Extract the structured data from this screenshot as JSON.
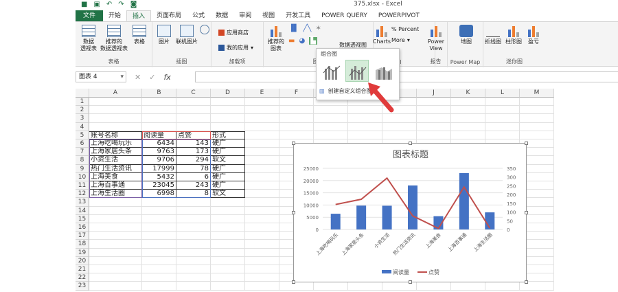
{
  "window": {
    "title": "375.xlsx - Excel"
  },
  "ribbon": {
    "tabs": [
      "文件",
      "开始",
      "插入",
      "页面布局",
      "公式",
      "数据",
      "审阅",
      "视图",
      "开发工具",
      "POWER QUERY",
      "POWERPIVOT"
    ],
    "active_tab": "插入",
    "groups": {
      "tables": {
        "label": "表格",
        "pivot": "数据\n透视表",
        "recommended_pivot": "推荐的\n数据透视表",
        "table": "表格"
      },
      "illustrations": {
        "label": "插图",
        "picture": "图片",
        "online_picture": "联机图片"
      },
      "addins": {
        "label": "加载项",
        "store": "应用商店",
        "my_apps": "我的应用"
      },
      "charts": {
        "label": "图表",
        "recommended": "推荐的\n图表",
        "pivot_chart": "数据透视图"
      },
      "extra_charts": {
        "charts": "Charts",
        "percent": "% Percent",
        "more": "More",
        "ll": "ll"
      },
      "reports": {
        "label": "报告",
        "power_view": "Power\nView"
      },
      "powermap": {
        "label": "Power Map",
        "map": "地图"
      },
      "sparklines": {
        "label": "迷你图",
        "line": "折线图",
        "column": "柱形图",
        "winloss": "盈亏"
      }
    }
  },
  "formula_bar": {
    "name_box": "图表 4",
    "fx": "fx"
  },
  "sheet": {
    "columns": [
      "A",
      "B",
      "C",
      "D",
      "E",
      "F",
      "G",
      "H",
      "I",
      "J",
      "K",
      "L",
      "M"
    ],
    "rows": [
      "1",
      "2",
      "3",
      "4",
      "5",
      "6",
      "7",
      "8",
      "9",
      "10",
      "11",
      "12",
      "13",
      "14",
      "15",
      "16",
      "17",
      "18",
      "19",
      "20",
      "21",
      "22",
      "23"
    ],
    "header": [
      "账号名称",
      "阅读量",
      "点赞",
      "形式"
    ],
    "data": [
      [
        "上海吃喝玩乐",
        "6434",
        "143",
        "硬广"
      ],
      [
        "上海家居头条",
        "9763",
        "173",
        "硬广"
      ],
      [
        "小资生活",
        "9706",
        "294",
        "软文"
      ],
      [
        "热门生活资讯",
        "17999",
        "78",
        "硬广"
      ],
      [
        "上海美食",
        "5432",
        "6",
        "硬广"
      ],
      [
        "上海百事通",
        "23045",
        "243",
        "硬广"
      ],
      [
        "上海生活圈",
        "6998",
        "8",
        "软文"
      ]
    ]
  },
  "combo_dropdown": {
    "title": "组合图",
    "custom": "创建自定义组合图..."
  },
  "chart_data": {
    "type": "bar",
    "title": "图表标题",
    "categories": [
      "上海吃喝玩乐",
      "上海家居头条",
      "小资生活",
      "热门生活资讯",
      "上海美食",
      "上海百事通",
      "上海生活圈"
    ],
    "series": [
      {
        "name": "阅读量",
        "type": "bar",
        "axis": "left",
        "color": "#4472c4",
        "values": [
          6434,
          9763,
          9706,
          17999,
          5432,
          23045,
          6998
        ]
      },
      {
        "name": "点赞",
        "type": "line",
        "axis": "right",
        "color": "#c0504d",
        "values": [
          143,
          173,
          294,
          78,
          6,
          243,
          8
        ]
      }
    ],
    "ylim": [
      0,
      25000
    ],
    "yticks": [
      "0",
      "5000",
      "10000",
      "15000",
      "20000",
      "25000"
    ],
    "y2lim": [
      0,
      350
    ],
    "y2ticks": [
      "0",
      "50",
      "100",
      "150",
      "200",
      "250",
      "300",
      "350"
    ],
    "legend": "bottom",
    "grid": true
  }
}
